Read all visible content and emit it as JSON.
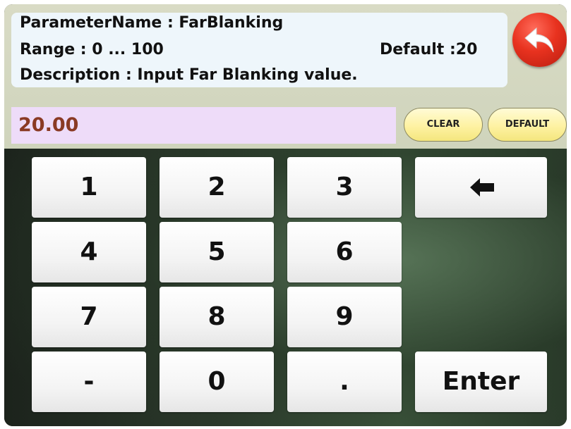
{
  "info": {
    "parameter_name": "ParameterName : FarBlanking",
    "range": "Range : 0 ... 100",
    "default": "Default :20",
    "description": "Description : Input Far Blanking value."
  },
  "back_button": {
    "icon": "back-arrow-icon",
    "color": "#e8321f"
  },
  "input": {
    "value": "20.00"
  },
  "buttons": {
    "clear": "CLEAR",
    "default": "DEFAULT"
  },
  "keypad": {
    "keys": [
      "1",
      "2",
      "3",
      "4",
      "5",
      "6",
      "7",
      "8",
      "9",
      "-",
      "0",
      "."
    ],
    "backspace_icon": "backspace-arrow-icon",
    "enter": "Enter"
  },
  "colors": {
    "input_bg": "#eedcf9",
    "input_text": "#8a3a24",
    "pill_bg": "#fef2a2"
  }
}
